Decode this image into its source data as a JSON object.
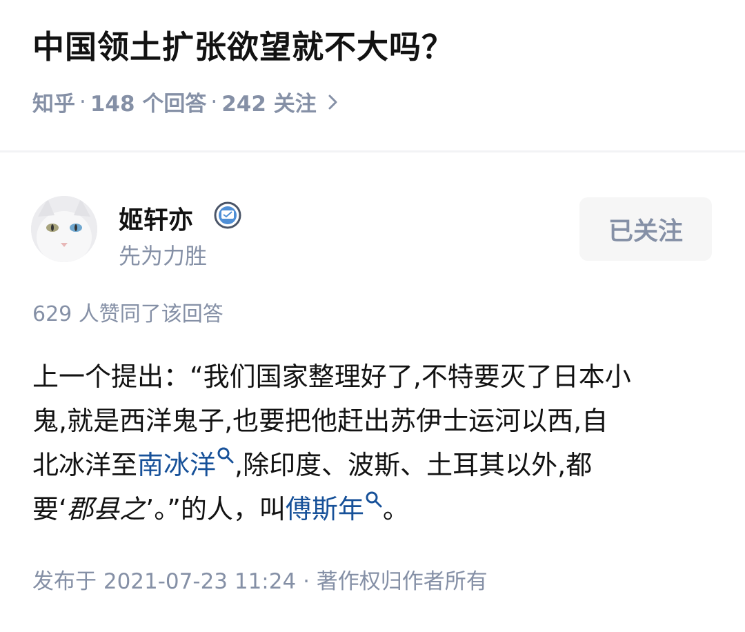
{
  "question": {
    "title": "中国领土扩张欲望就不大吗？",
    "source": "知乎",
    "answers": "148 个回答",
    "follows": "242 关注"
  },
  "author": {
    "name": "姬轩亦",
    "bio": "先为力胜",
    "follow_button": "已关注"
  },
  "answer": {
    "votes": "629 人赞同了该回答",
    "lines": [
      {
        "text": "上一个提出：“我们国家整理好了,不特要灭了日本小"
      },
      {
        "text": "鬼,就是西洋鬼子,也要把他赶出苏伊士运河以西,自"
      },
      {
        "pre": "北冰洋至",
        "link": "南冰洋",
        "post": ",除印度、波斯、土耳其以外,都"
      },
      {
        "pre": "要‘",
        "italic": "郡县之",
        "mid": "’。”的人，叫",
        "link": "傅斯年",
        "post": "。"
      }
    ],
    "published": "发布于 2021-07-23 11:24",
    "copyright": "著作权归作者所有"
  },
  "colors": {
    "meta_gray": "#8590a6",
    "link_blue": "#175199",
    "text": "#121212"
  },
  "icons": [
    "chevron-right-icon",
    "verified-badge-icon",
    "search-icon"
  ]
}
